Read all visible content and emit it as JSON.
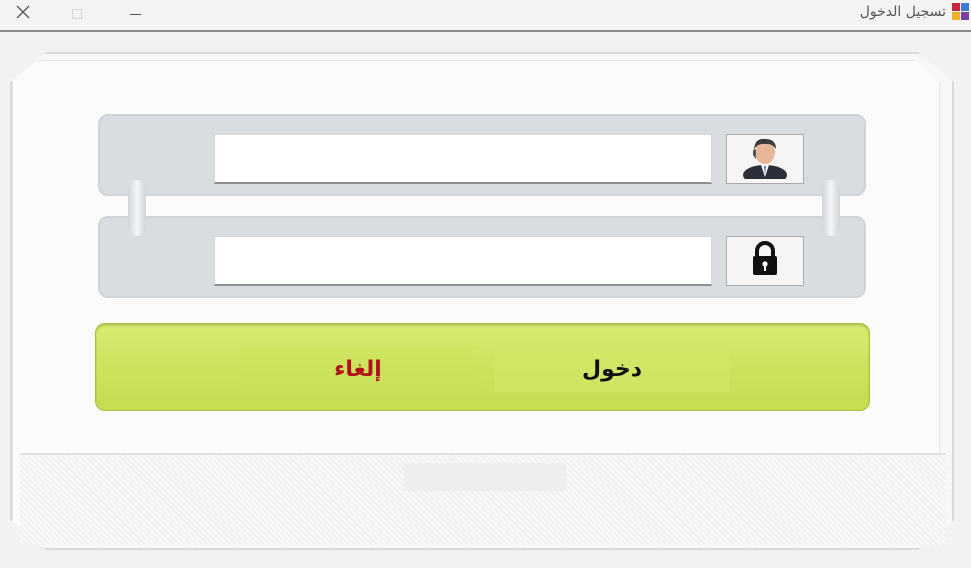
{
  "window": {
    "title": "تسجيل الدخول",
    "close_icon": "close-icon",
    "maximize_icon": "maximize-icon",
    "minimize_icon": "minimize-icon",
    "app_icon": "app-grid-icon"
  },
  "form": {
    "username": {
      "value": "",
      "placeholder": "",
      "icon": "user-avatar-icon"
    },
    "password": {
      "value": "",
      "placeholder": "",
      "icon": "lock-icon"
    }
  },
  "buttons": {
    "login_label": "دخول",
    "cancel_label": "إلغاء"
  },
  "colors": {
    "button_bar": "#cde35e",
    "cancel_text": "#b0121c",
    "login_text": "#111111"
  }
}
